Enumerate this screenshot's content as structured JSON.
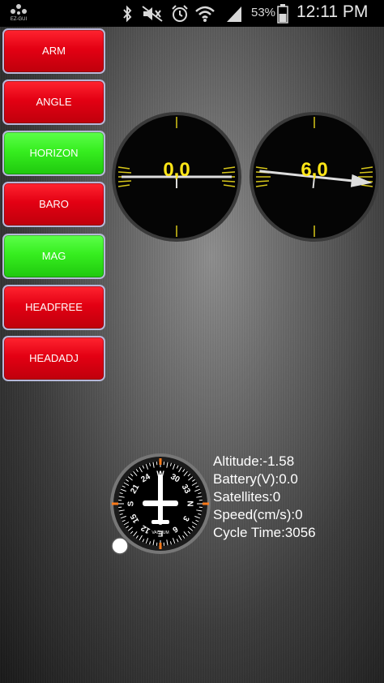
{
  "status_bar": {
    "app_icon_label": "EZ-GUI",
    "battery_percent": "53%",
    "time": "12:11 PM"
  },
  "mode_buttons": [
    {
      "label": "ARM",
      "active": false
    },
    {
      "label": "ANGLE",
      "active": false
    },
    {
      "label": "HORIZON",
      "active": true
    },
    {
      "label": "BARO",
      "active": false
    },
    {
      "label": "MAG",
      "active": true
    },
    {
      "label": "HEADFREE",
      "active": false
    },
    {
      "label": "HEADADJ",
      "active": false
    }
  ],
  "gauges": {
    "left": {
      "value": "0,0",
      "angle_deg": 0
    },
    "right": {
      "value": "6,0",
      "angle_deg": 6
    }
  },
  "heading": {
    "ticks": [
      "N",
      "3",
      "6",
      "E",
      "12",
      "15",
      "S",
      "21",
      "24",
      "W",
      "30",
      "33"
    ],
    "label": "VACUUM"
  },
  "telemetry": {
    "altitude": "Altitude:-1.58",
    "battery": "Battery(V):0.0",
    "satellites": "Satellites:0",
    "speed": "Speed(cm/s):0",
    "cycle_time": "Cycle Time:3056"
  },
  "colors": {
    "button_on": "#36ee1f",
    "button_off": "#e30013",
    "gauge_value": "#ffe617"
  }
}
